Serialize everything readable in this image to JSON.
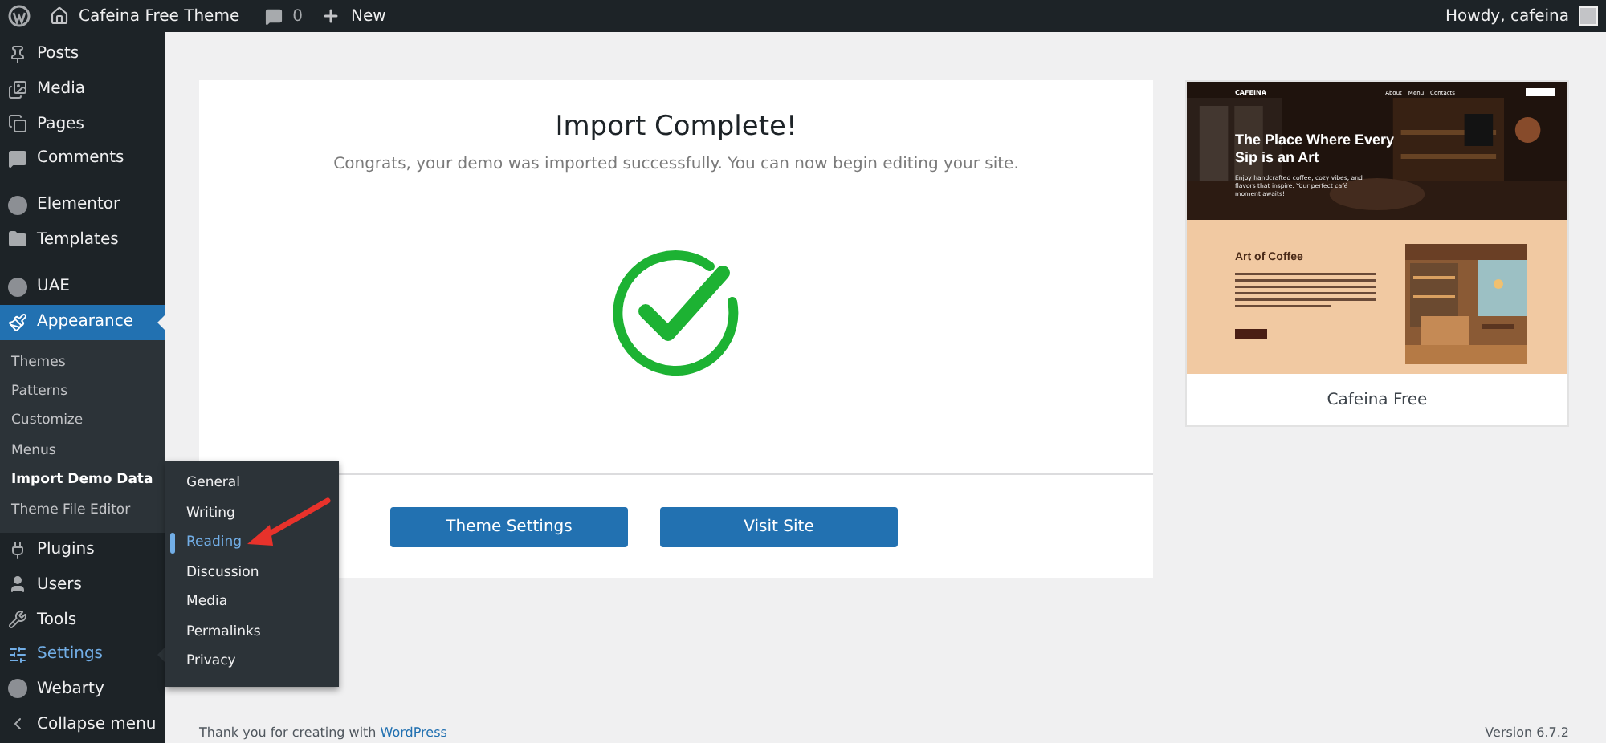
{
  "admin_bar": {
    "site_name": "Cafeina Free Theme",
    "comments_count": "0",
    "new_label": "New",
    "greeting": "Howdy, cafeina"
  },
  "sidebar": {
    "groups": [
      {
        "items": [
          {
            "label": "Posts",
            "selected": false,
            "hovered": false
          },
          {
            "label": "Media",
            "selected": false,
            "hovered": false
          },
          {
            "label": "Pages",
            "selected": false,
            "hovered": false
          },
          {
            "label": "Comments",
            "selected": false,
            "hovered": false
          }
        ]
      },
      {
        "items": [
          {
            "label": "Elementor",
            "selected": false,
            "hovered": false
          },
          {
            "label": "Templates",
            "selected": false,
            "hovered": false
          }
        ]
      },
      {
        "items": [
          {
            "label": "UAE",
            "selected": false,
            "hovered": false
          },
          {
            "label": "Appearance",
            "selected": true,
            "hovered": false,
            "children": [
              {
                "label": "Themes",
                "selected": false
              },
              {
                "label": "Patterns",
                "selected": false
              },
              {
                "label": "Customize",
                "selected": false
              },
              {
                "label": "Menus",
                "selected": false
              },
              {
                "label": "Import Demo Data",
                "selected": true
              },
              {
                "label": "Theme File Editor",
                "selected": false
              }
            ]
          },
          {
            "label": "Plugins",
            "selected": false,
            "hovered": false
          },
          {
            "label": "Users",
            "selected": false,
            "hovered": false
          },
          {
            "label": "Tools",
            "selected": false,
            "hovered": false
          },
          {
            "label": "Settings",
            "selected": false,
            "hovered": true
          },
          {
            "label": "Webarty",
            "selected": false,
            "hovered": false
          },
          {
            "label": "Collapse menu",
            "selected": false,
            "hovered": false
          }
        ]
      }
    ]
  },
  "flyout": {
    "items": [
      {
        "label": "General",
        "selected": false
      },
      {
        "label": "Writing",
        "selected": false
      },
      {
        "label": "Reading",
        "selected": true
      },
      {
        "label": "Discussion",
        "selected": false
      },
      {
        "label": "Media",
        "selected": false
      },
      {
        "label": "Permalinks",
        "selected": false
      },
      {
        "label": "Privacy",
        "selected": false
      }
    ]
  },
  "import_card": {
    "title": "Import Complete!",
    "message": "Congrats, your demo was imported successfully. You can now begin editing your site.",
    "buttons": [
      "Theme Settings",
      "Visit Site"
    ]
  },
  "theme_preview": {
    "brand": "CAFEINA",
    "nav": [
      "About",
      "Menu",
      "Contacts"
    ],
    "hero_title": "The Place Where Every Sip is an Art",
    "hero_text": "Enjoy handcrafted coffee, cozy vibes, and flavors that inspire. Your perfect café moment awaits!",
    "section_title": "Art of Coffee",
    "theme_name": "Cafeina Free"
  },
  "footer": {
    "thanks": "Thank you for creating with",
    "link": "WordPress",
    "version": "Version 6.7.2"
  }
}
